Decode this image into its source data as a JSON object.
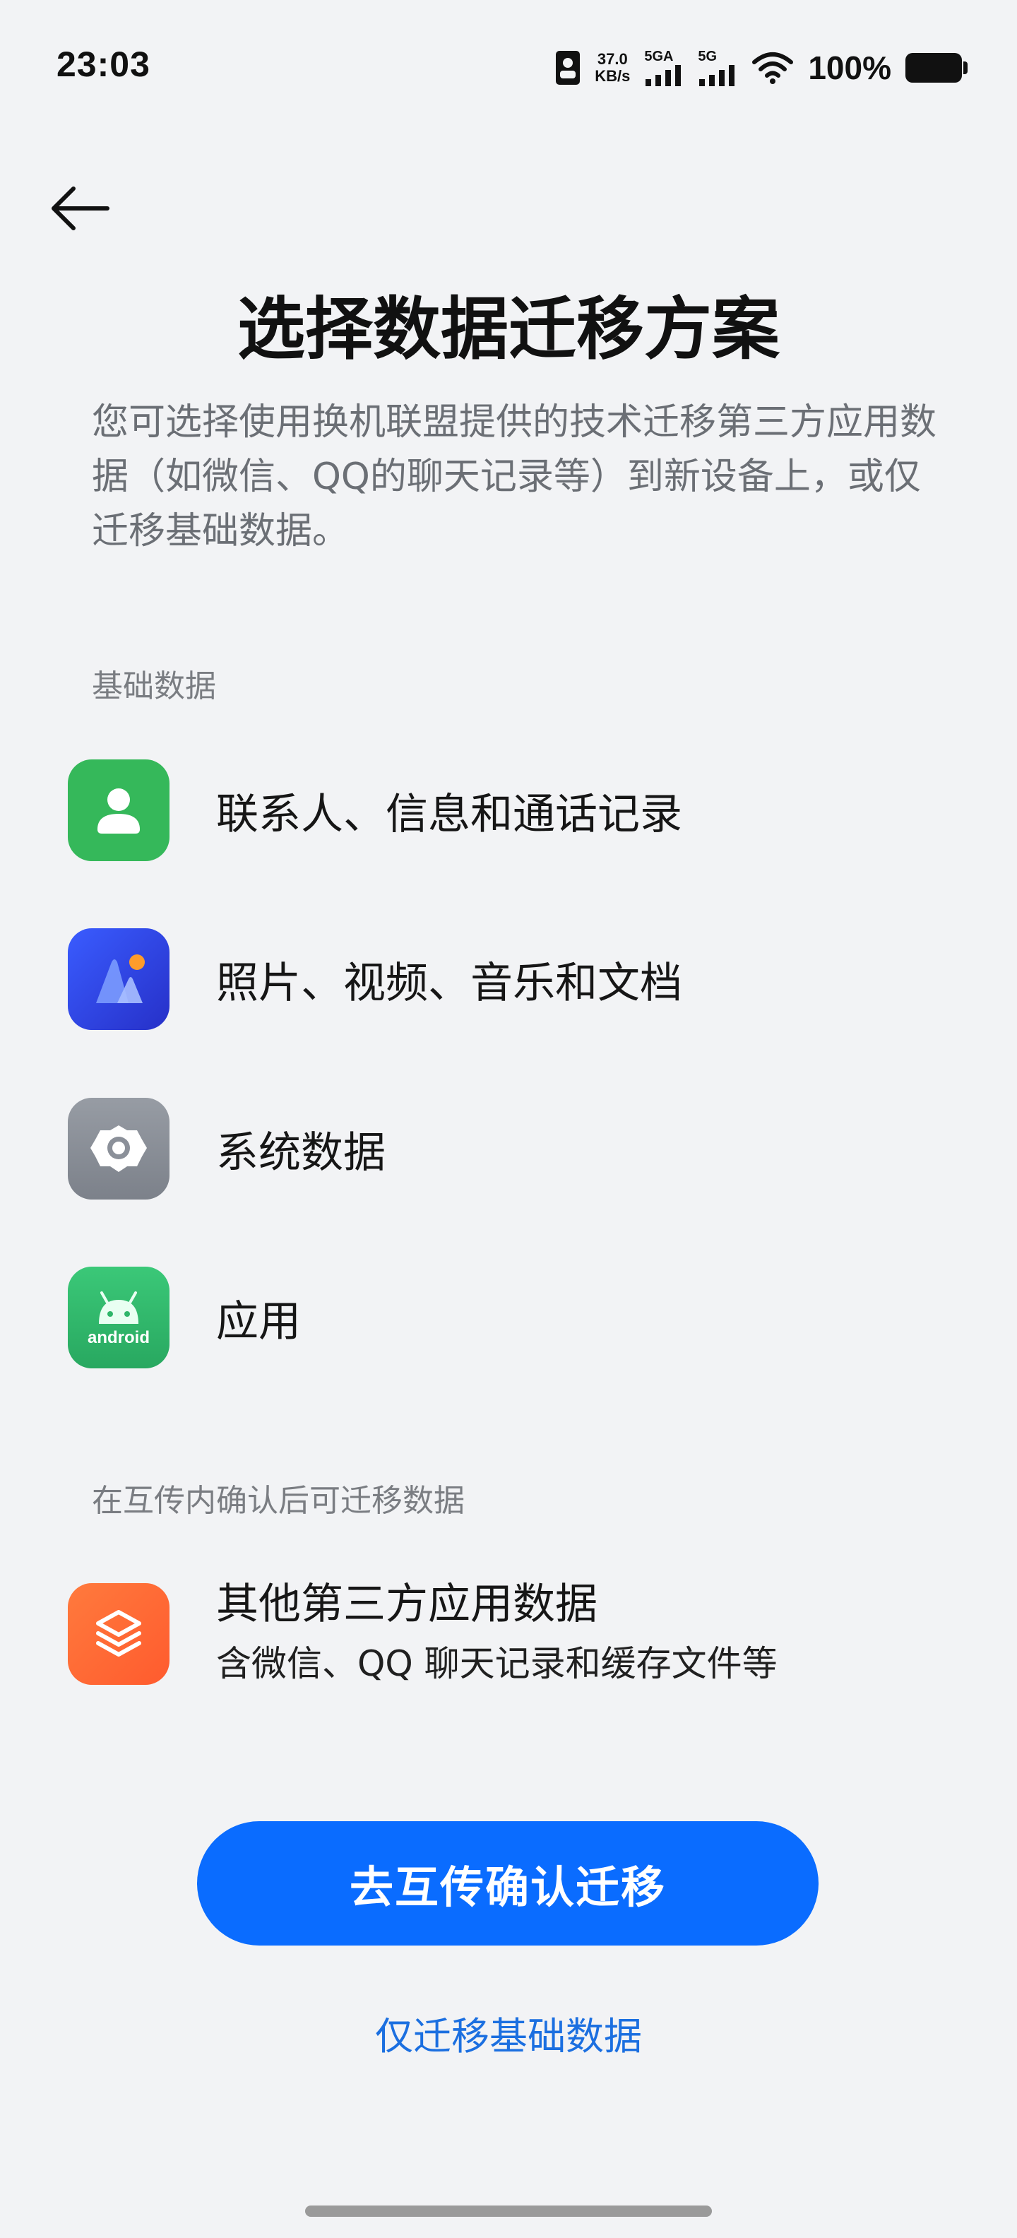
{
  "status_bar": {
    "time": "23:03",
    "speed_value": "37.0",
    "speed_unit": "KB/s",
    "sim1_label": "5GA",
    "sim2_label": "5G",
    "battery_percent": "100%",
    "icons": [
      "sim-card-icon",
      "signal-icon",
      "signal-icon",
      "wifi-icon",
      "battery-icon"
    ]
  },
  "header": {
    "title": "选择数据迁移方案",
    "description": "您可选择使用换机联盟提供的技术迁移第三方应用数据（如微信、QQ的聊天记录等）到新设备上，或仅迁移基础数据。"
  },
  "basic_section": {
    "label": "基础数据",
    "items": [
      {
        "label": "联系人、信息和通话记录",
        "icon": "contacts-icon",
        "color": "#35b85a"
      },
      {
        "label": "照片、视频、音乐和文档",
        "icon": "gallery-icon",
        "color": "#2d49e6"
      },
      {
        "label": "系统数据",
        "icon": "settings-gear-icon",
        "color": "#8b9099"
      },
      {
        "label": "应用",
        "icon": "android-icon",
        "color": "#2fb66a",
        "icon_text": "android"
      }
    ]
  },
  "third_party_section": {
    "label": "在互传内确认后可迁移数据",
    "item": {
      "title": "其他第三方应用数据",
      "subtitle": "含微信、QQ 聊天记录和缓存文件等",
      "icon": "layers-icon",
      "color": "#ff6b35"
    }
  },
  "actions": {
    "primary_label": "去互传确认迁移",
    "secondary_label": "仅迁移基础数据",
    "primary_color": "#0a6cff"
  }
}
